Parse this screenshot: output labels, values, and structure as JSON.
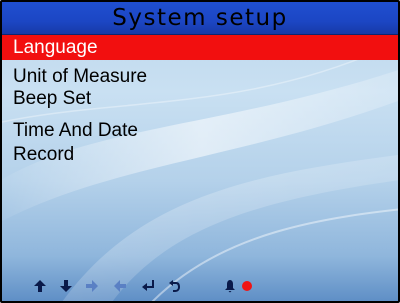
{
  "header": {
    "title": "System setup"
  },
  "menu": {
    "items": [
      {
        "label": "Language",
        "selected": true
      },
      {
        "label": "Unit of Measure",
        "selected": false
      },
      {
        "label": "Beep Set",
        "selected": false
      },
      {
        "label": "Time And Date",
        "selected": false
      },
      {
        "label": "Record",
        "selected": false
      }
    ]
  },
  "status_bar": {
    "icons": [
      {
        "name": "arrow-up-icon",
        "color": "#0a1a4a",
        "enabled": true
      },
      {
        "name": "arrow-down-icon",
        "color": "#0a1a4a",
        "enabled": true
      },
      {
        "name": "arrow-right-icon",
        "color": "#5a80c4",
        "enabled": false
      },
      {
        "name": "arrow-left-icon",
        "color": "#5a80c4",
        "enabled": false
      },
      {
        "name": "enter-icon",
        "color": "#0a1a4a",
        "enabled": true
      },
      {
        "name": "back-icon",
        "color": "#0a1a4a",
        "enabled": true
      },
      {
        "name": "bell-icon",
        "color": "#0a1a4a",
        "enabled": true
      },
      {
        "name": "record-dot-icon",
        "color": "#f01414",
        "enabled": true
      }
    ]
  },
  "colors": {
    "title_bar": "#1f4fd0",
    "selection": "#f20f0f",
    "background": "#bcd6ec"
  }
}
